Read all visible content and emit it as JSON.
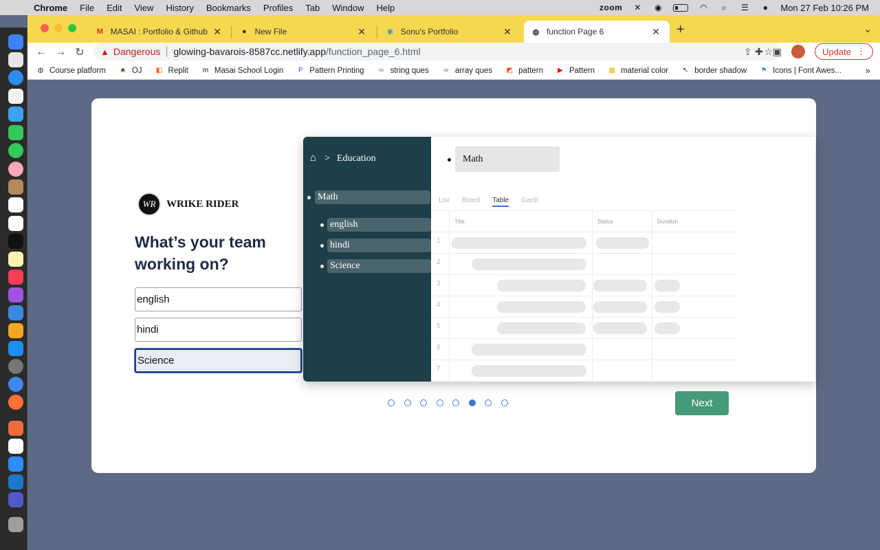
{
  "menubar": {
    "app_name": "Chrome",
    "items": [
      "File",
      "Edit",
      "View",
      "History",
      "Bookmarks",
      "Profiles",
      "Tab",
      "Window",
      "Help"
    ],
    "zoom_label": "zoom",
    "datetime": "Mon 27 Feb  10:26 PM"
  },
  "tabs": [
    {
      "title": "MASAI : Portfolio & Github Fee",
      "icon": "gmail-icon",
      "fav_text": "M",
      "fav_color": "#d93025"
    },
    {
      "title": "New File",
      "icon": "github-icon",
      "fav_text": "●",
      "fav_color": "#333333"
    },
    {
      "title": "Sonu's Portfolio",
      "icon": "react-icon",
      "fav_text": "⚛",
      "fav_color": "#1d8acb"
    },
    {
      "title": "function Page 6",
      "icon": "globe-icon",
      "fav_text": "◍",
      "fav_color": "#333333"
    }
  ],
  "address": {
    "security_label": "Dangerous",
    "host": "glowing-bavarois-8587cc.netlify.app",
    "path": "/function_page_6.html"
  },
  "toolbar": {
    "update_label": "Update"
  },
  "bookmarks": [
    {
      "label": "Course platform",
      "icon": "globe-icon",
      "glyph": "◍",
      "color": "#333333"
    },
    {
      "label": "OJ",
      "icon": "tree-icon",
      "glyph": "♣",
      "color": "#6b3e1f"
    },
    {
      "label": "Replit",
      "icon": "replit-icon",
      "glyph": "◧",
      "color": "#f26207"
    },
    {
      "label": "Masai School Login",
      "icon": "masai-icon",
      "glyph": "m",
      "color": "#111111"
    },
    {
      "label": "Pattern Printing",
      "icon": "bookmark-p-icon",
      "glyph": "P",
      "color": "#6a3de8"
    },
    {
      "label": "string ques",
      "icon": "gfg-icon",
      "glyph": "∞",
      "color": "#2f8d46"
    },
    {
      "label": "array ques",
      "icon": "gfg-icon",
      "glyph": "∞",
      "color": "#2f8d46"
    },
    {
      "label": "pattern",
      "icon": "scratch-icon",
      "glyph": "◩",
      "color": "#e44d26"
    },
    {
      "label": "Pattern",
      "icon": "youtube-icon",
      "glyph": "▶",
      "color": "#ff0000"
    },
    {
      "label": "material color",
      "icon": "palette-icon",
      "glyph": "▦",
      "color": "#f4b400"
    },
    {
      "label": "border shadow",
      "icon": "cursor-icon",
      "glyph": "↖",
      "color": "#222222"
    },
    {
      "label": "Icons | Font Awes...",
      "icon": "flag-icon",
      "glyph": "⚑",
      "color": "#528dd7"
    }
  ],
  "page": {
    "brand_logo_text": "WR",
    "brand_name": "WRIKE RIDER",
    "question": "What’s your team working on?",
    "inputs": [
      "english",
      "hindi",
      "Science"
    ],
    "next_label": "Next",
    "pager": {
      "total": 8,
      "active": 6
    }
  },
  "preview": {
    "breadcrumb_label": "Education",
    "parent_item": "Math",
    "children": [
      "english",
      "hindi",
      "Science"
    ],
    "selected_item": "Math",
    "view_tabs": [
      "List",
      "Board",
      "Table",
      "Gantt"
    ],
    "active_view": "Table",
    "columns": [
      "Title",
      "Status",
      "Duration"
    ],
    "row_numbers": [
      "1",
      "2",
      "3",
      "4",
      "5",
      "6",
      "7"
    ]
  }
}
